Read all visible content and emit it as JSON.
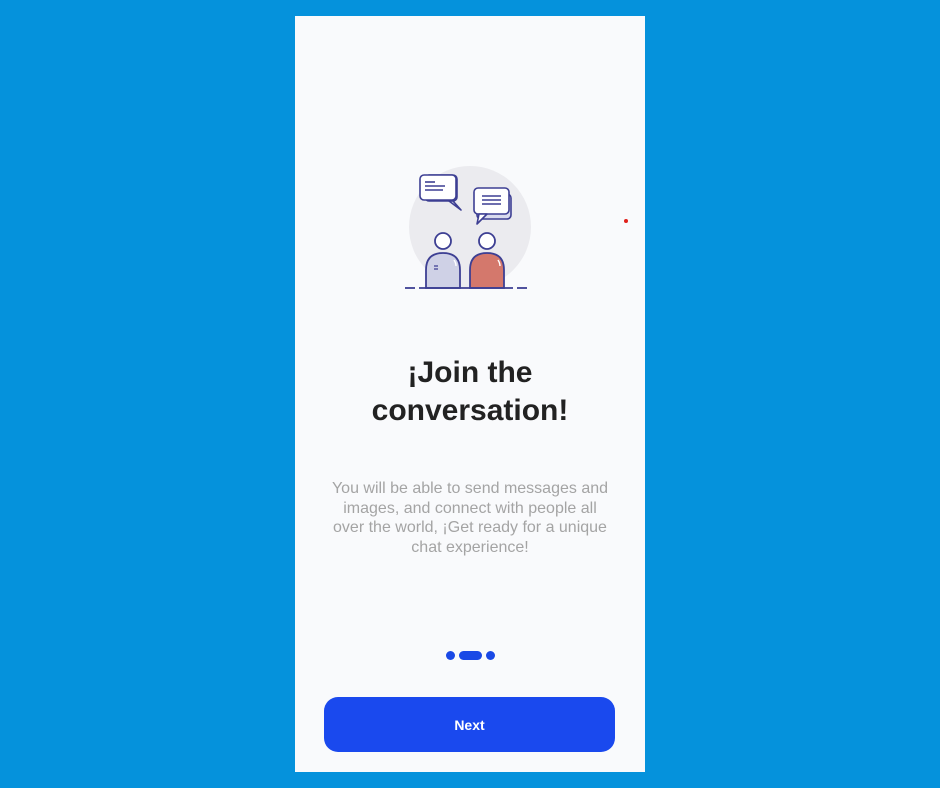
{
  "onboarding": {
    "title_line1": "¡Join the",
    "title_line2": "conversation!",
    "description_line1": "You will be able to send messages and",
    "description_line2": "images, and connect with people all",
    "description_line3": "over the world, ¡Get ready for a unique",
    "description_line4": "chat experience!",
    "illustration": "two-people-chatting-illustration",
    "pagination": {
      "total_pages": 3,
      "current_page": 2
    },
    "next_label": "Next"
  },
  "colors": {
    "background": "#0592dc",
    "screen": "#f9fafc",
    "primary": "#1a49ee",
    "title": "#222222",
    "description": "#a4a4a4",
    "person_left": "#cfd1e6",
    "person_right": "#d4786c",
    "outline": "#3d3f93"
  }
}
